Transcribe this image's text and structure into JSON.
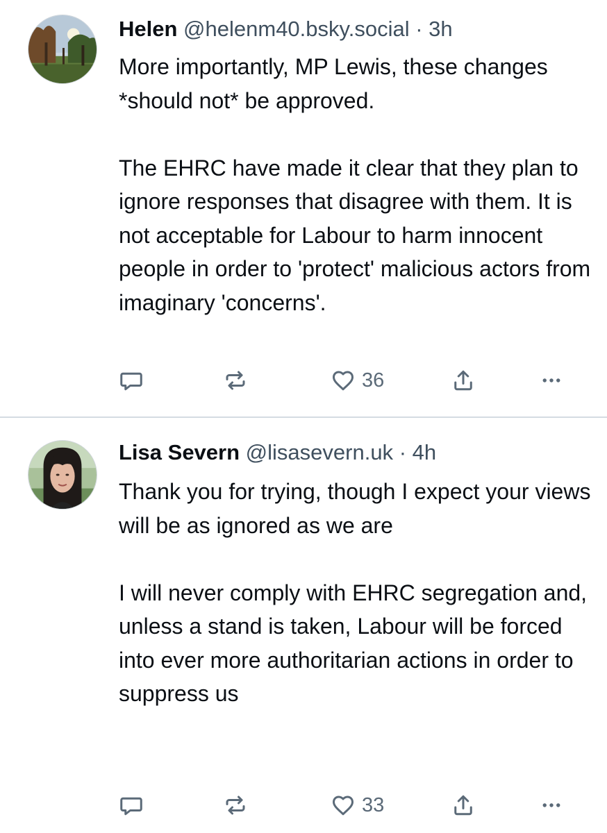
{
  "posts": [
    {
      "author": {
        "display_name": "Helen",
        "handle": "@helenm40.bsky.social"
      },
      "separator": "·",
      "time": "3h",
      "paragraphs": [
        "More importantly, MP Lewis, these changes *should not* be approved.",
        "The EHRC have made it clear that they plan to ignore responses that disagree with them. It is not acceptable for Labour to harm innocent people in order to 'protect' malicious actors from imaginary 'concerns'."
      ],
      "likes": "36",
      "icons": [
        "reply-icon",
        "repost-icon",
        "like-icon",
        "share-icon",
        "more-icon"
      ]
    },
    {
      "author": {
        "display_name": "Lisa Severn",
        "handle": "@lisasevern.uk"
      },
      "separator": "·",
      "time": "4h",
      "paragraphs": [
        "Thank you for trying, though I expect your views will be as ignored as we are",
        "I will never comply with EHRC segregation and, unless a stand is taken, Labour will be forced into ever more authoritarian actions in order to suppress us"
      ],
      "likes": "33",
      "icons": [
        "reply-icon",
        "repost-icon",
        "like-icon",
        "share-icon",
        "more-icon"
      ]
    }
  ],
  "colors": {
    "text": "#0b0f14",
    "secondary_text": "#3f4f5e",
    "icon": "#5b6a78",
    "divider": "#d4dbe2"
  }
}
